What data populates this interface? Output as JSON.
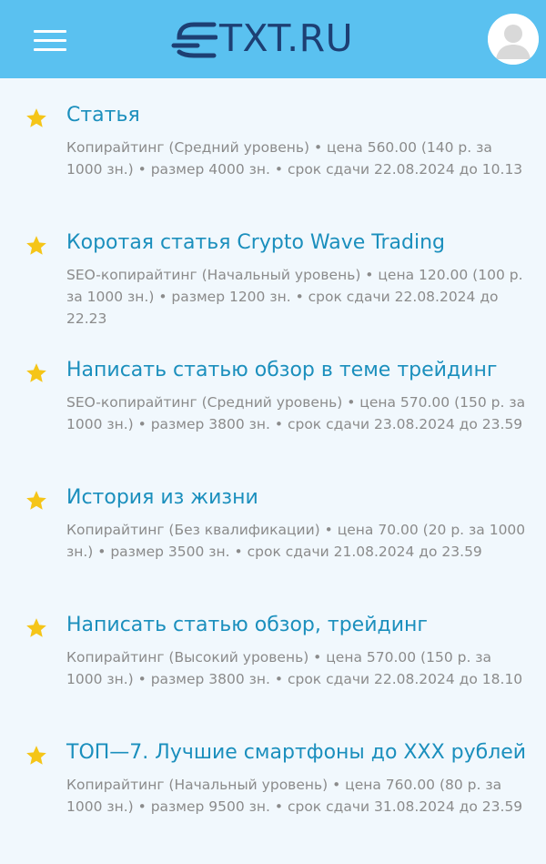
{
  "header": {
    "logo_text": "TXT.RU",
    "brand_color": "#1d3f73",
    "background_color": "#5ac1f0",
    "menu_icon": "hamburger-icon",
    "avatar_icon": "user-avatar-icon"
  },
  "orders": [
    {
      "title": "Статья",
      "description": "Копирайтинг (Средний уровень) • цена 560.00 (140 р. за 1000 зн.) • размер 4000 зн. • срок сдачи 22.08.2024 до 10.13"
    },
    {
      "title": "Коротая статья Crypto Wave Trading",
      "description": "SEO-копирайтинг (Начальный уровень) • цена 120.00 (100 р. за 1000 зн.) • размер 1200 зн. • срок сдачи 22.08.2024 до 22.23"
    },
    {
      "title": "Написать статью обзор в теме трейдинг",
      "description": "SEO-копирайтинг (Средний уровень) • цена 570.00 (150 р. за 1000 зн.) • размер 3800 зн. • срок сдачи 23.08.2024 до 23.59"
    },
    {
      "title": "История из жизни",
      "description": "Копирайтинг (Без квалификации) • цена 70.00 (20 р. за 1000 зн.) • размер 3500 зн. • срок сдачи 21.08.2024 до 23.59"
    },
    {
      "title": "Написать статью обзор, трейдинг",
      "description": "Копирайтинг (Высокий уровень) • цена 570.00 (150 р. за 1000 зн.) • размер 3800 зн. • срок сдачи 22.08.2024 до 18.10"
    },
    {
      "title": "ТОП—7. Лучшие смартфоны до XXX рублей",
      "description": "Копирайтинг (Начальный уровень) • цена 760.00 (80 р. за 1000 зн.) • размер 9500 зн. • срок сдачи 31.08.2024 до 23.59"
    }
  ],
  "colors": {
    "title": "#1b8fbd",
    "description": "#8b8b8b",
    "star": "#f5c518",
    "page_background": "#f1f8fd"
  },
  "item_icon": "star-icon"
}
